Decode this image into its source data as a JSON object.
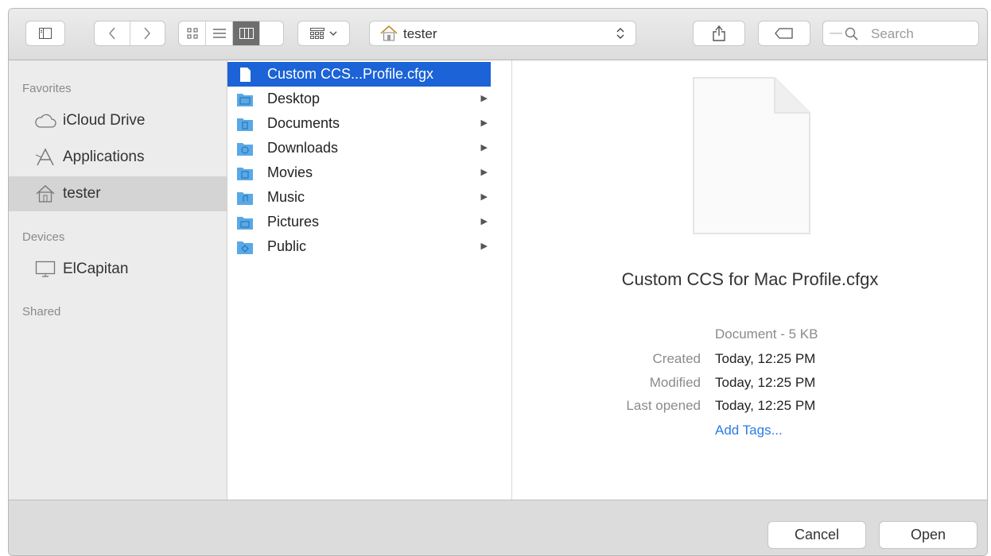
{
  "toolbar": {
    "location": "tester",
    "search_placeholder": "Search"
  },
  "sidebar": {
    "favorites_heading": "Favorites",
    "devices_heading": "Devices",
    "shared_heading": "Shared",
    "favorites": [
      {
        "label": "iCloud Drive",
        "icon": "cloud-icon"
      },
      {
        "label": "Applications",
        "icon": "applications-icon"
      },
      {
        "label": "tester",
        "icon": "home-icon",
        "selected": true
      }
    ],
    "devices": [
      {
        "label": "ElCapitan",
        "icon": "display-icon"
      }
    ]
  },
  "column": {
    "items": [
      {
        "label": "Custom CCS...Profile.cfgx",
        "type": "file",
        "selected": true
      },
      {
        "label": "Desktop",
        "type": "folder"
      },
      {
        "label": "Documents",
        "type": "folder"
      },
      {
        "label": "Downloads",
        "type": "folder"
      },
      {
        "label": "Movies",
        "type": "folder"
      },
      {
        "label": "Music",
        "type": "folder"
      },
      {
        "label": "Pictures",
        "type": "folder"
      },
      {
        "label": "Public",
        "type": "folder"
      }
    ]
  },
  "preview": {
    "filename": "Custom CCS for Mac Profile.cfgx",
    "kind": "Document - 5 KB",
    "created_label": "Created",
    "created_value": "Today, 12:25 PM",
    "modified_label": "Modified",
    "modified_value": "Today, 12:25 PM",
    "opened_label": "Last opened",
    "opened_value": "Today, 12:25 PM",
    "add_tags": "Add Tags..."
  },
  "footer": {
    "cancel": "Cancel",
    "open": "Open"
  },
  "colors": {
    "selection": "#1b63d6",
    "folder": "#5aa9e6",
    "link": "#2c7be5"
  }
}
